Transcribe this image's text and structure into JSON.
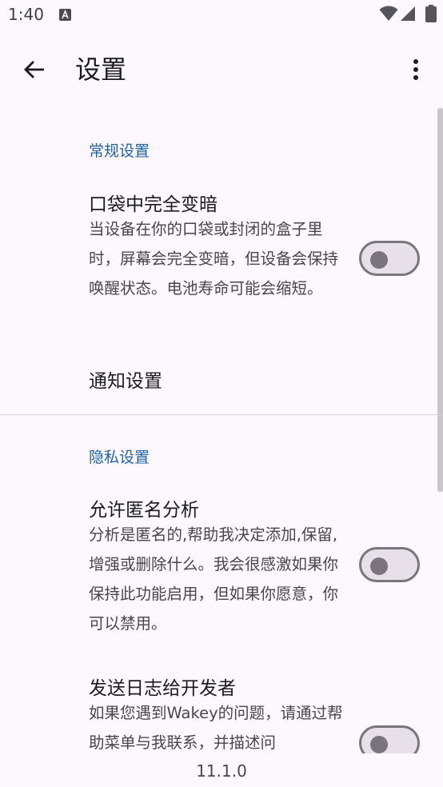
{
  "status_bar": {
    "time": "1:40"
  },
  "app_bar": {
    "title": "设置"
  },
  "sections": {
    "general": {
      "header": "常规设置",
      "dim_in_pocket": {
        "title": "口袋中完全变暗",
        "summary": "当设备在你的口袋或封闭的盒子里时，屏幕会完全变暗，但设备会保持唤醒状态。电池寿命可能会缩短。",
        "enabled": false
      },
      "notification_settings": {
        "title": "通知设置"
      }
    },
    "privacy": {
      "header": "隐私设置",
      "anonymous_analytics": {
        "title": "允许匿名分析",
        "summary": "分析是匿名的,帮助我决定添加,保留,增强或删除什么。我会很感激如果你保持此功能启用，但如果你愿意，你可以禁用。",
        "enabled": false
      },
      "send_logs": {
        "title": "发送日志给开发者",
        "summary": "如果您遇到Wakey的问题，请通过帮助菜单与我联系，并描述问",
        "enabled": false
      }
    }
  },
  "footer": {
    "version": "11.1.0"
  },
  "colors": {
    "accent": "#1e63a8",
    "background": "#fdf8fd",
    "switch_off_track": "#e7e0e8",
    "switch_off_outline": "#79747e"
  }
}
